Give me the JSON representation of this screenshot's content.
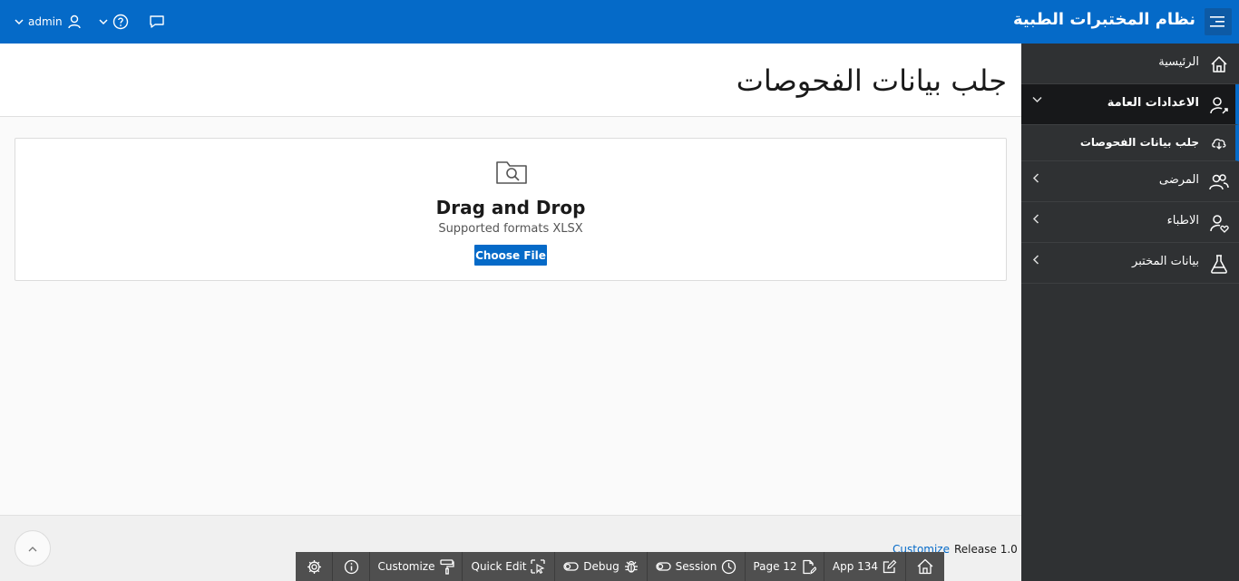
{
  "header": {
    "app_title": "نظام المختبرات الطبية",
    "user_name": "admin"
  },
  "sidebar": {
    "items": [
      {
        "label": "الرئيسية",
        "icon": "home-icon"
      },
      {
        "label": "الاعدادات العامة",
        "icon": "user-settings-icon",
        "expanded": true
      },
      {
        "label": "جلب بيانات الفحوصات",
        "icon": "cloud-download-icon",
        "current": true
      },
      {
        "label": "المرضى",
        "icon": "users-icon"
      },
      {
        "label": "الاطباء",
        "icon": "user-heart-icon"
      },
      {
        "label": "بيانات المختبر",
        "icon": "flask-icon"
      }
    ]
  },
  "main": {
    "page_title": "جلب بيانات الفحوصات",
    "dropzone": {
      "title": "Drag and Drop",
      "subtitle": "Supported formats XLSX",
      "button_label": "Choose File"
    }
  },
  "footer": {
    "customize_label": "Customize",
    "release_label": "Release 1.0"
  },
  "dev_toolbar": {
    "customize_label": "Customize",
    "quick_edit_label": "Quick Edit",
    "debug_label": "Debug",
    "session_label": "Session",
    "page_label": "Page 12",
    "app_label": "App 134"
  },
  "colors": {
    "brand_blue": "#056ac8",
    "sidebar_bg": "#2f3133",
    "sidebar_active_bg": "#17181a",
    "devbar_bg": "#4f4f4f"
  }
}
